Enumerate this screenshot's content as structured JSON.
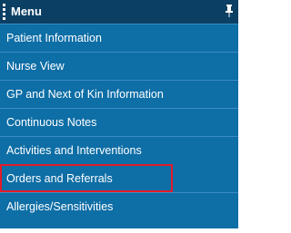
{
  "menu": {
    "title": "Menu",
    "items": [
      {
        "label": "Patient Information"
      },
      {
        "label": "Nurse View"
      },
      {
        "label": "GP and Next of Kin Information"
      },
      {
        "label": "Continuous Notes"
      },
      {
        "label": "Activities and Interventions"
      },
      {
        "label": "Orders and Referrals",
        "highlighted": true
      },
      {
        "label": "Allergies/Sensitivities"
      }
    ]
  },
  "colors": {
    "header": "#0b3f63",
    "panel": "#0e6ea6",
    "highlight_border": "#e11b2a"
  },
  "icons": {
    "grip": "drag-handle-icon",
    "pin": "pin-icon"
  }
}
